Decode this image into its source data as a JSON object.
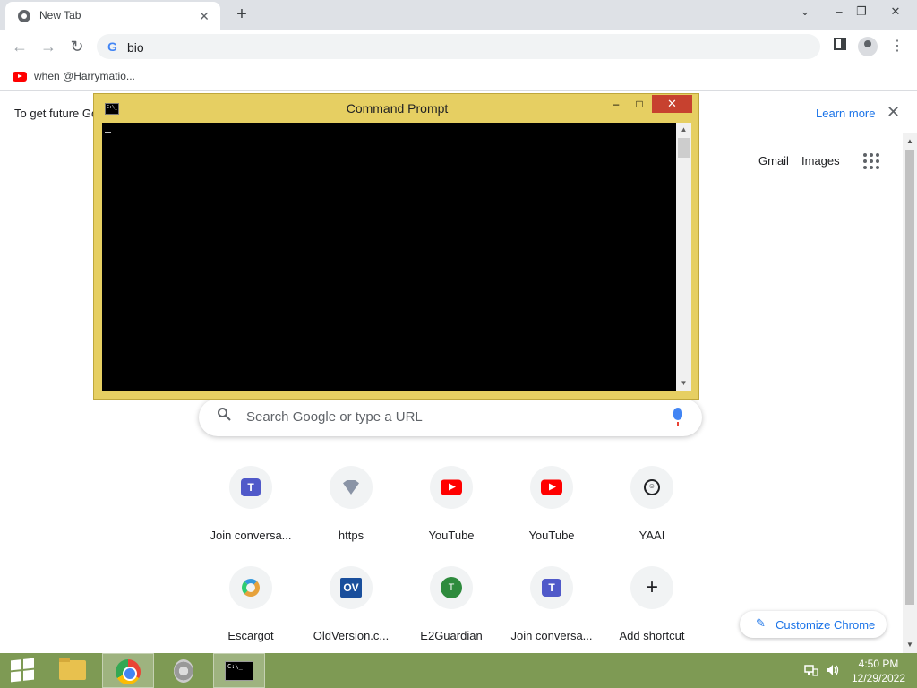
{
  "browser": {
    "tab": {
      "title": "New Tab",
      "close": "✕"
    },
    "new_tab": "+",
    "window_controls": {
      "dropdown": "⌄",
      "minimize": "–",
      "restore": "❐",
      "close": "✕"
    },
    "toolbar": {
      "back": "←",
      "forward": "→",
      "reload": "↻",
      "omnibox_value": "bio",
      "omnibox_icon": "G",
      "menu": "⋮"
    },
    "bookmarks": [
      {
        "label": "when @Harrymatio...",
        "icon": "youtube-icon"
      }
    ],
    "infobar": {
      "message": "To get future Go",
      "learn_more": "Learn more",
      "close": "✕"
    }
  },
  "ntp": {
    "top_links": {
      "gmail": "Gmail",
      "images": "Images"
    },
    "search_placeholder": "Search Google or type a URL",
    "shortcuts": [
      {
        "label": "Join conversa...",
        "icon": "teams-icon"
      },
      {
        "label": "https",
        "icon": "https-icon"
      },
      {
        "label": "YouTube",
        "icon": "youtube-icon"
      },
      {
        "label": "YouTube",
        "icon": "youtube-icon"
      },
      {
        "label": "YAAI",
        "icon": "smiley-icon"
      },
      {
        "label": "Escargot",
        "icon": "escargot-icon"
      },
      {
        "label": "OldVersion.c...",
        "icon": "oldversion-icon"
      },
      {
        "label": "E2Guardian",
        "icon": "e2guardian-icon"
      },
      {
        "label": "Join conversa...",
        "icon": "teams-icon"
      },
      {
        "label": "Add shortcut",
        "icon": "plus-icon"
      }
    ],
    "shortcut_glyphs": {
      "teams": "T",
      "ov": "OV",
      "e2": "T",
      "plus": "+",
      "smile": "☺"
    },
    "customize": "Customize Chrome"
  },
  "cmd": {
    "title": "Command Prompt",
    "icon_text": "C:\\_",
    "minimize": "–",
    "maximize": "□",
    "close": "✕"
  },
  "taskbar": {
    "time": "4:50 PM",
    "date": "12/29/2022",
    "cmd_icon_text": "C:\\_"
  },
  "colors": {
    "cmd_frame": "#e6cf62",
    "taskbar": "#7e9a54",
    "link": "#1a73e8",
    "close_red": "#c7412f"
  }
}
